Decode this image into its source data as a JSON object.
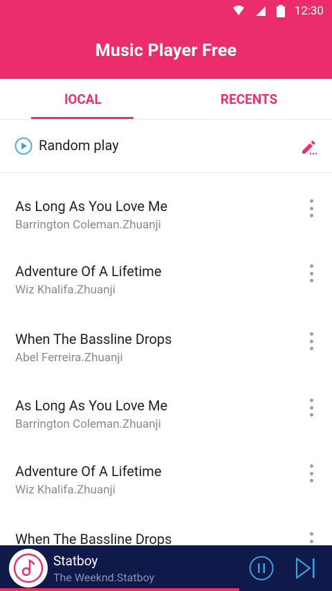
{
  "status_bar": {
    "time": "12:30"
  },
  "app_bar": {
    "title": "Music Player Free"
  },
  "tabs": [
    {
      "label": "lOCAL",
      "active": true
    },
    {
      "label": "RECENTS",
      "active": false
    }
  ],
  "random_play": {
    "label": "Random play"
  },
  "songs": [
    {
      "title": "As Long As You Love Me",
      "artist": "Barrington Coleman.Zhuanji"
    },
    {
      "title": "Adventure Of A Lifetime",
      "artist": "Wiz Khalifa.Zhuanji"
    },
    {
      "title": "When The Bassline Drops",
      "artist": "Abel Ferreira.Zhuanji"
    },
    {
      "title": "As Long As You Love Me",
      "artist": "Barrington Coleman.Zhuanji"
    },
    {
      "title": "Adventure Of A Lifetime",
      "artist": "Wiz Khalifa.Zhuanji"
    },
    {
      "title": "When The Bassline Drops",
      "artist": ""
    }
  ],
  "now_playing": {
    "title": "Statboy",
    "artist": "The Weeknd.Statboy",
    "progress_fraction": 0.72
  },
  "colors": {
    "accent": "#ec2d6c",
    "player_bg": "#0f1a4a",
    "play_icon_blue": "#3aa0e0"
  }
}
